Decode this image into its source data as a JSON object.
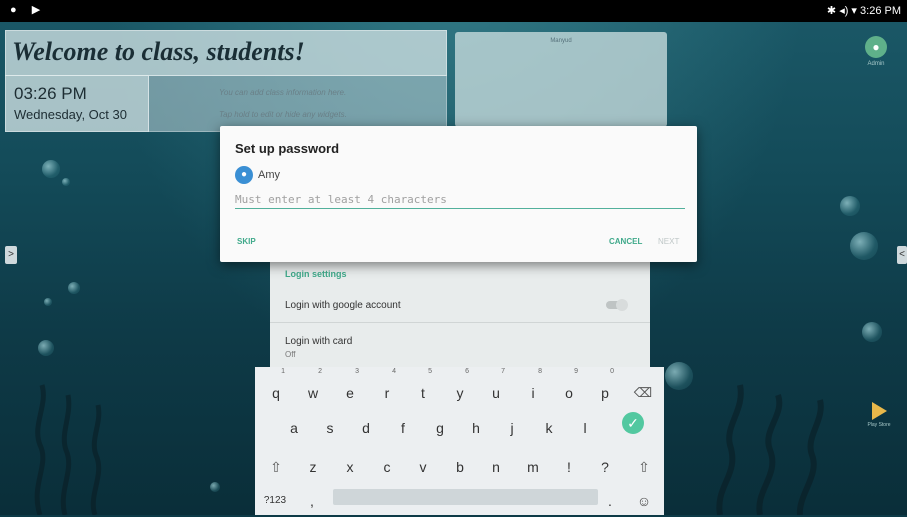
{
  "status_bar": {
    "time": "3:26 PM",
    "left_icons": "● ▶",
    "right_icons": "✱ ◂) ▾"
  },
  "welcome": {
    "title": "Welcome to class, students!"
  },
  "clock": {
    "time": "03:26 PM",
    "date": "Wednesday, Oct 30"
  },
  "info": {
    "line1": "You can add class information here.",
    "line2": "Tap hold to edit or hide any widgets."
  },
  "side_card": {
    "label": "Manyud"
  },
  "admin": {
    "name": "Admin"
  },
  "play_store": {
    "name": "Play Store"
  },
  "nav": {
    "left_arrow": ">",
    "right_arrow": "<"
  },
  "settings": {
    "header": "Login settings",
    "row1": "Login with google account",
    "row2": "Login with card",
    "row2_sub": "Off"
  },
  "dialog": {
    "title": "Set up password",
    "user": "Amy",
    "password_placeholder": "Must enter at least 4 characters",
    "skip": "SKIP",
    "cancel": "CANCEL",
    "next": "NEXT"
  },
  "keyboard": {
    "row1": [
      "q",
      "w",
      "e",
      "r",
      "t",
      "y",
      "u",
      "i",
      "o",
      "p"
    ],
    "row1_hints": [
      "1",
      "2",
      "3",
      "4",
      "5",
      "6",
      "7",
      "8",
      "9",
      "0"
    ],
    "row2": [
      "a",
      "s",
      "d",
      "f",
      "g",
      "h",
      "j",
      "k",
      "l"
    ],
    "row3": [
      "z",
      "x",
      "c",
      "v",
      "b",
      "n",
      "m",
      "!",
      "?"
    ],
    "symbols": "?123",
    "comma": ",",
    "period": "."
  },
  "colors": {
    "accent": "#3fa98a",
    "done_key": "#52c8a0",
    "avatar": "#3a8fd4",
    "admin_avatar": "#5fb08a"
  }
}
